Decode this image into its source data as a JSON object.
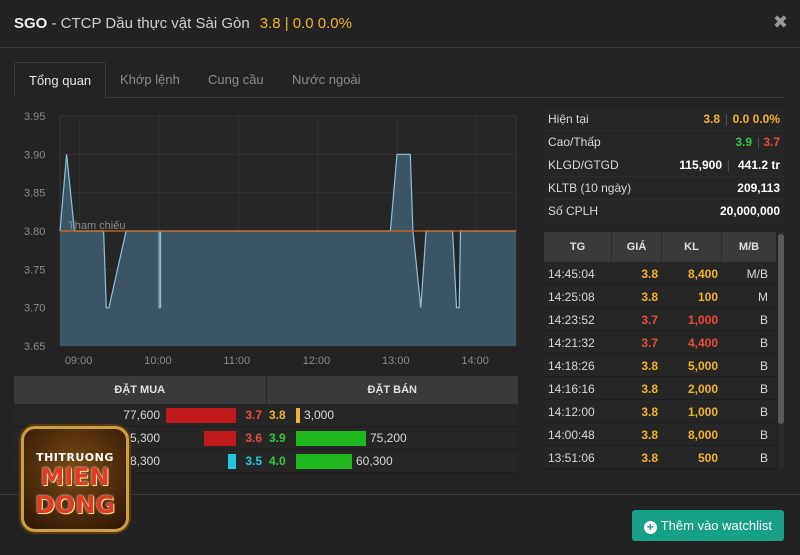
{
  "colors": {
    "up": "#f0b429",
    "green": "#2ecc40",
    "red": "#e74c3c",
    "cyan": "#1ecbe1",
    "accent": "#16a085"
  },
  "header": {
    "symbol": "SGO",
    "name": " - CTCP Dầu thực vật Sài Gòn",
    "price_info": "3.8 | 0.0 0.0%",
    "close_icon": "close-icon"
  },
  "tabs": [
    {
      "label": "Tổng quan"
    },
    {
      "label": "Khớp lệnh"
    },
    {
      "label": "Cung cầu"
    },
    {
      "label": "Nước ngoài"
    }
  ],
  "chart_data": {
    "type": "area",
    "title": "",
    "ylim": [
      3.65,
      3.95
    ],
    "yticks": [
      "3.95",
      "3.90",
      "3.85",
      "3.80",
      "3.75",
      "3.70",
      "3.65"
    ],
    "xticks": [
      "09:00",
      "10:00",
      "11:00",
      "12:00",
      "13:00",
      "14:00"
    ],
    "reference_label": "Tham chiếu",
    "reference_value": 3.8,
    "series": [
      {
        "x": [
          "08:45",
          "08:50",
          "08:56",
          "09:01",
          "09:05",
          "09:18",
          "09:20",
          "09:22",
          "09:35",
          "09:38",
          "10:00",
          "10:00",
          "10:01",
          "10:01",
          "11:00",
          "12:00",
          "12:55",
          "13:00",
          "13:05",
          "13:10",
          "13:12",
          "13:18",
          "13:22",
          "13:42",
          "13:45",
          "13:47",
          "13:48",
          "13:52",
          "14:30"
        ],
        "values": [
          3.8,
          3.9,
          3.8,
          3.8,
          3.8,
          3.8,
          3.7,
          3.7,
          3.8,
          3.8,
          3.8,
          3.7,
          3.7,
          3.8,
          3.8,
          3.8,
          3.8,
          3.9,
          3.9,
          3.9,
          3.8,
          3.7,
          3.8,
          3.8,
          3.7,
          3.7,
          3.8,
          3.8,
          3.8
        ]
      }
    ]
  },
  "orderbook": {
    "buy_header": "ĐẶT MUA",
    "sell_header": "ĐẶT BÁN",
    "rows": [
      {
        "buy_vol": "77,600",
        "buy_price": "3.7",
        "buy_ratio": 1.0,
        "sell_price": "3.8",
        "sell_vol": "3,000",
        "sell_ratio": 0.05
      },
      {
        "buy_vol": "35,300",
        "buy_price": "3.6",
        "buy_ratio": 0.45,
        "sell_price": "3.9",
        "sell_vol": "75,200",
        "sell_ratio": 1.0
      },
      {
        "buy_vol": "8,300",
        "buy_price": "3.5",
        "buy_ratio": 0.11,
        "sell_price": "4.0",
        "sell_vol": "60,300",
        "sell_ratio": 0.8
      }
    ]
  },
  "info": {
    "current_label": "Hiện tại",
    "current_price": "3.8",
    "current_change": "0.0 0.0%",
    "hilo_label": "Cao/Thấp",
    "high": "3.9",
    "low": "3.7",
    "sep": "|",
    "vol_label": "KLGD/GTGD",
    "volume": "115,900",
    "value": "441.2 tr",
    "avg_label": "KLTB (10 ngày)",
    "avg_volume": "209,113",
    "shares_label": "Số CPLH",
    "shares": "20,000,000"
  },
  "trades": {
    "headers": [
      "TG",
      "GIÁ",
      "KL",
      "M/B"
    ],
    "rows": [
      {
        "time": "14:45:04",
        "price": "3.8",
        "vol": "8,400",
        "side": "M/B",
        "color": "yellow"
      },
      {
        "time": "14:25:08",
        "price": "3.8",
        "vol": "100",
        "side": "M",
        "color": "yellow"
      },
      {
        "time": "14:23:52",
        "price": "3.7",
        "vol": "1,000",
        "side": "B",
        "color": "red"
      },
      {
        "time": "14:21:32",
        "price": "3.7",
        "vol": "4,400",
        "side": "B",
        "color": "red"
      },
      {
        "time": "14:18:26",
        "price": "3.8",
        "vol": "5,000",
        "side": "B",
        "color": "yellow"
      },
      {
        "time": "14:16:16",
        "price": "3.8",
        "vol": "2,000",
        "side": "B",
        "color": "yellow"
      },
      {
        "time": "14:12:00",
        "price": "3.8",
        "vol": "1,000",
        "side": "B",
        "color": "yellow"
      },
      {
        "time": "14:00:48",
        "price": "3.8",
        "vol": "8,000",
        "side": "B",
        "color": "yellow"
      },
      {
        "time": "13:51:06",
        "price": "3.8",
        "vol": "500",
        "side": "B",
        "color": "yellow"
      }
    ]
  },
  "footer": {
    "watch_button": "Thêm vào watchlist",
    "watch_icon": "plus-circle-icon"
  },
  "logo": {
    "line1": "THITRUONG",
    "line2": "MIEN",
    "line3": "DONG"
  }
}
